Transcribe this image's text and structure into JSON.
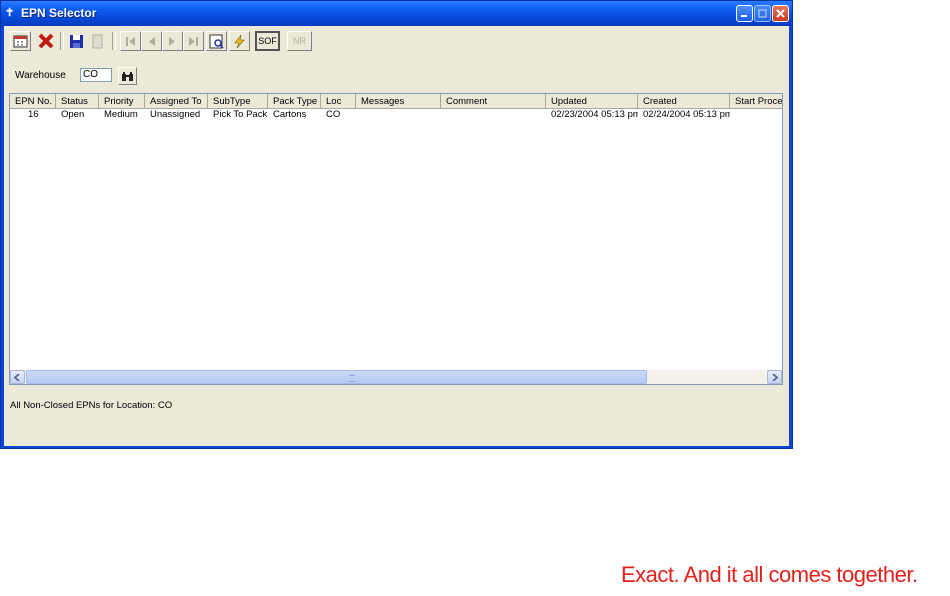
{
  "window": {
    "title": "EPN Selector",
    "title_icon": "app-icon"
  },
  "toolbar": {
    "buttons": [
      {
        "name": "calendar-icon",
        "enabled": true
      },
      {
        "name": "delete-icon",
        "enabled": true
      },
      {
        "name": "save-icon",
        "enabled": true
      },
      {
        "name": "copy-icon",
        "enabled": false
      },
      {
        "name": "first-record-icon",
        "enabled": false
      },
      {
        "name": "previous-record-icon",
        "enabled": false
      },
      {
        "name": "next-record-icon",
        "enabled": false
      },
      {
        "name": "last-record-icon",
        "enabled": false
      },
      {
        "name": "preview-icon",
        "enabled": true
      },
      {
        "name": "lightning-icon",
        "enabled": true
      }
    ],
    "sof_label": "SOF",
    "nr_label": "NR"
  },
  "warehouse": {
    "label": "Warehouse",
    "value": "CO"
  },
  "grid": {
    "columns": [
      "EPN No.",
      "Status",
      "Priority",
      "Assigned To",
      "SubType",
      "Pack Type",
      "Loc",
      "Messages",
      "Comment",
      "Updated",
      "Created",
      "Start Proce"
    ],
    "rows": [
      [
        "16",
        "Open",
        "Medium",
        "Unassigned",
        "Pick To Pack",
        "Cartons",
        "CO",
        "",
        "",
        "02/23/2004 05:13 pm",
        "02/24/2004 05:13 pm",
        ""
      ]
    ]
  },
  "status_text": "All Non-Closed EPNs for Location: CO",
  "slogan": "Exact. And it all comes together.",
  "colors": {
    "titlebar": "#0a5cf0",
    "client": "#ece9d8",
    "slogan": "#e3201b"
  }
}
